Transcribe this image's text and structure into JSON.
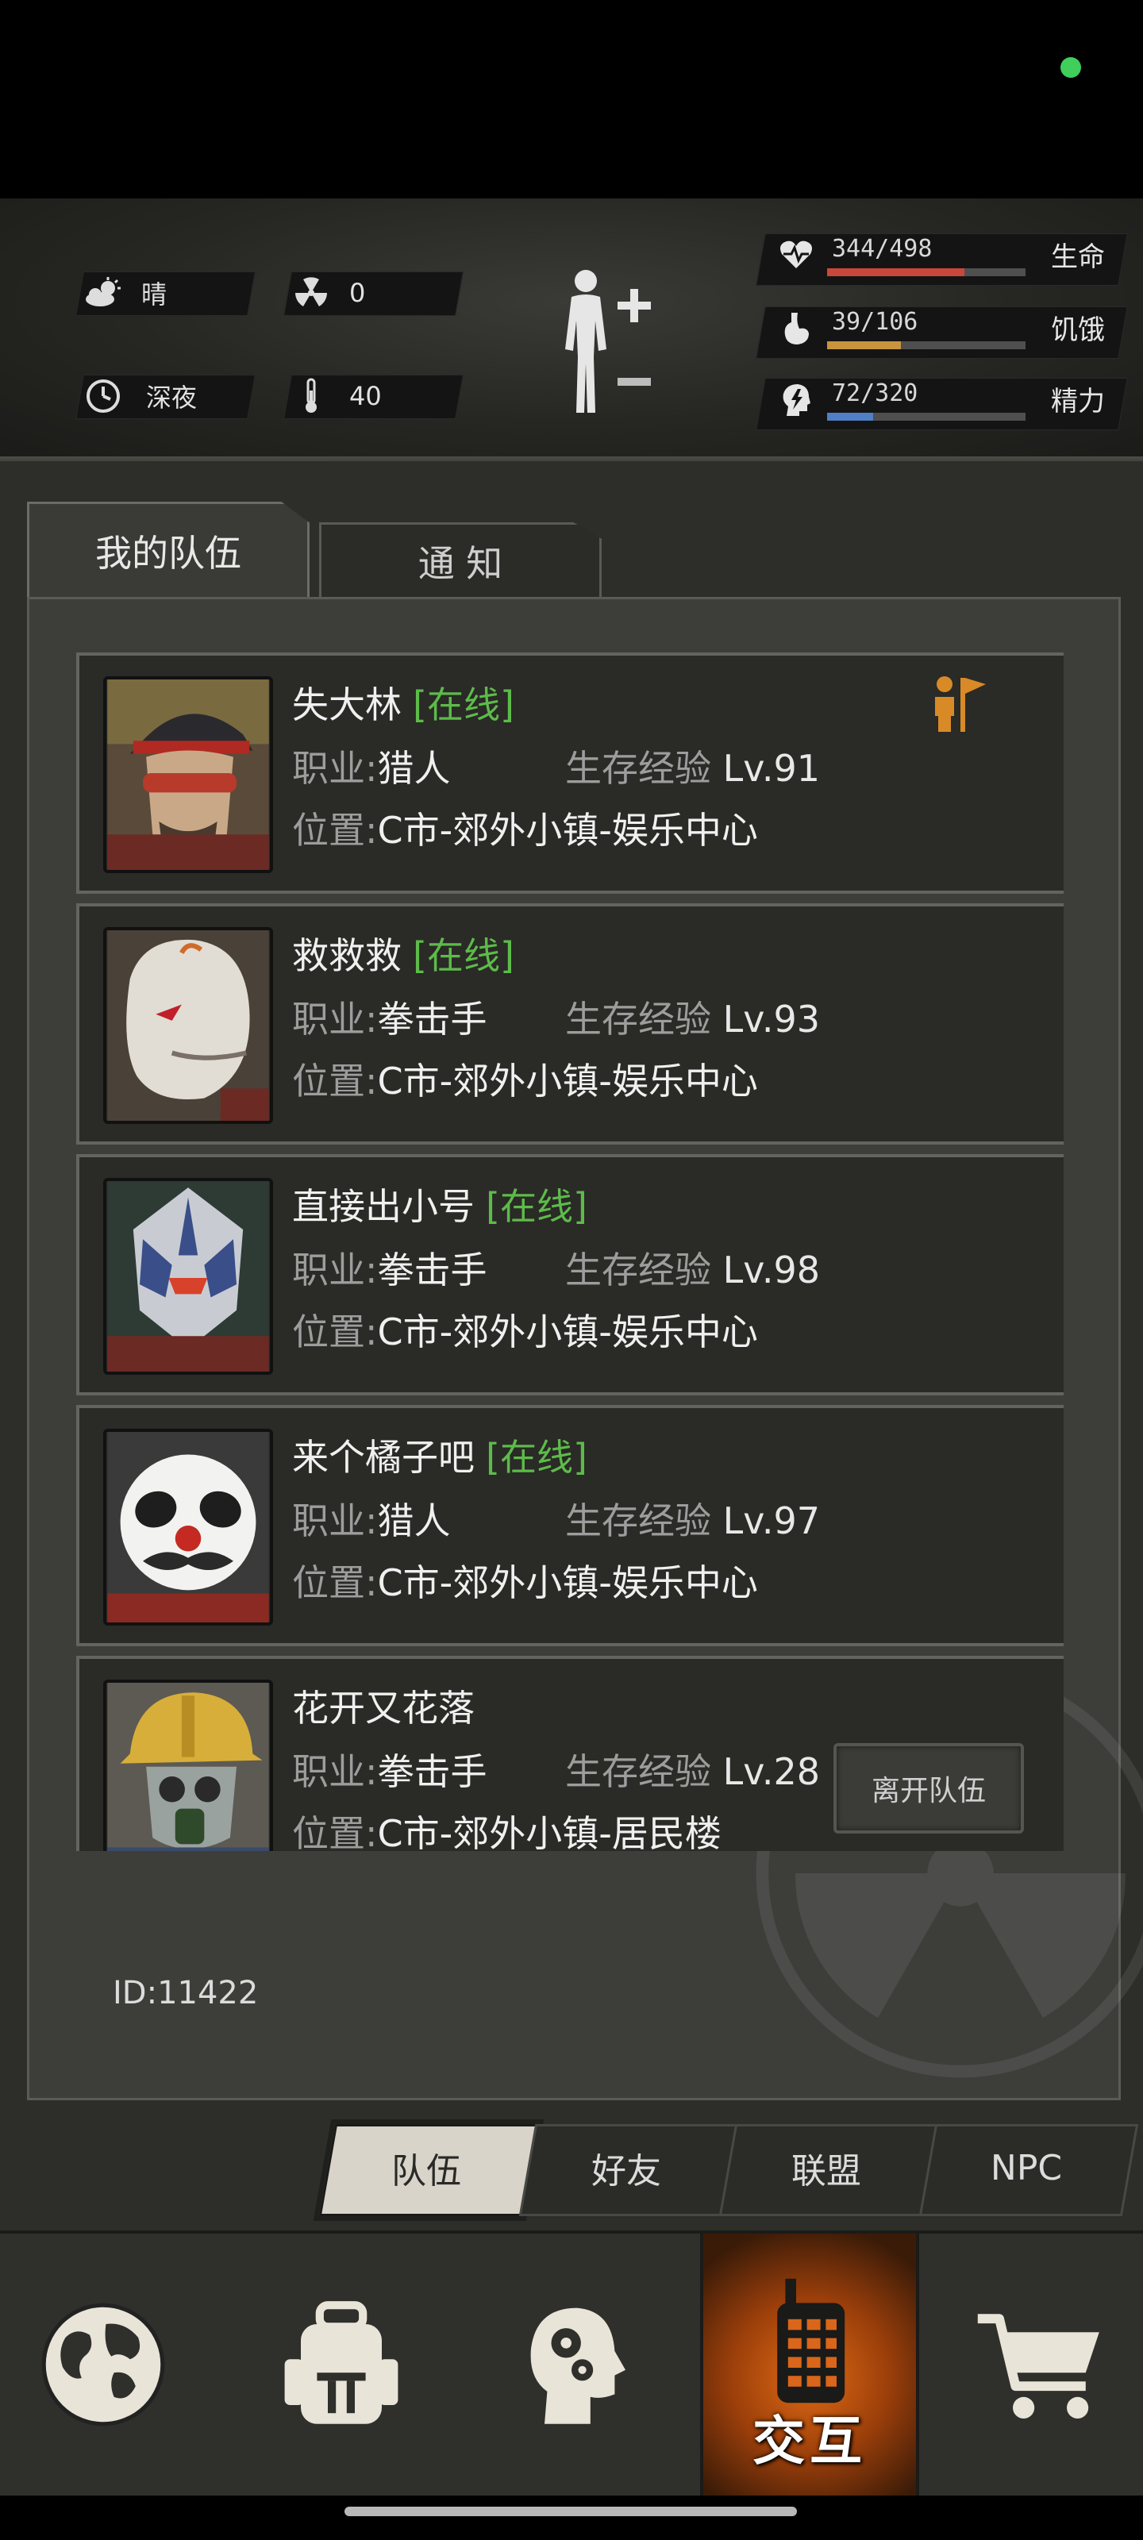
{
  "header": {
    "weather": {
      "icon": "partly-cloudy-icon",
      "text": "晴"
    },
    "radiation": {
      "icon": "radiation-icon",
      "value": "0"
    },
    "time": {
      "icon": "clock-icon",
      "text": "深夜"
    },
    "temperature": {
      "icon": "thermometer-icon",
      "value": "40"
    },
    "stats": [
      {
        "label": "生命",
        "value": "344/498",
        "fraction": 0.69,
        "color": "#c9473b",
        "icon": "heart-pulse-icon"
      },
      {
        "label": "饥饿",
        "value": "39/106",
        "fraction": 0.37,
        "color": "#c9943b",
        "icon": "stomach-icon"
      },
      {
        "label": "精力",
        "value": "72/320",
        "fraction": 0.23,
        "color": "#4f7fc4",
        "icon": "energy-head-icon"
      }
    ]
  },
  "tabs": {
    "team": "我的队伍",
    "notice": "通 知"
  },
  "members": [
    {
      "name": "失大林",
      "online": "[在线]",
      "job_label": "职业:",
      "job": "猎人",
      "exp_label": "生存经验",
      "level": "Lv.91",
      "loc_label": "位置:",
      "location": "C市-郊外小镇-娱乐中心",
      "leader": true
    },
    {
      "name": "救救救",
      "online": "[在线]",
      "job_label": "职业:",
      "job": "拳击手",
      "exp_label": "生存经验",
      "level": "Lv.93",
      "loc_label": "位置:",
      "location": "C市-郊外小镇-娱乐中心"
    },
    {
      "name": "直接出小号",
      "online": "[在线]",
      "job_label": "职业:",
      "job": "拳击手",
      "exp_label": "生存经验",
      "level": "Lv.98",
      "loc_label": "位置:",
      "location": "C市-郊外小镇-娱乐中心"
    },
    {
      "name": "来个橘子吧",
      "online": "[在线]",
      "job_label": "职业:",
      "job": "猎人",
      "exp_label": "生存经验",
      "level": "Lv.97",
      "loc_label": "位置:",
      "location": "C市-郊外小镇-娱乐中心"
    },
    {
      "name": "花开又花落",
      "online": "",
      "job_label": "职业:",
      "job": "拳击手",
      "exp_label": "生存经验",
      "level": "Lv.28",
      "loc_label": "位置:",
      "location": "C市-郊外小镇-居民楼",
      "leave_button": "离开队伍"
    }
  ],
  "user_id": "ID:11422",
  "subtabs": [
    "队伍",
    "好友",
    "联盟",
    "NPC"
  ],
  "subtab_active": 0,
  "nav": {
    "interact_label": "交互",
    "items": [
      "globe-icon",
      "backpack-icon",
      "skills-head-icon",
      "walkie-talkie-icon",
      "cart-icon"
    ]
  }
}
